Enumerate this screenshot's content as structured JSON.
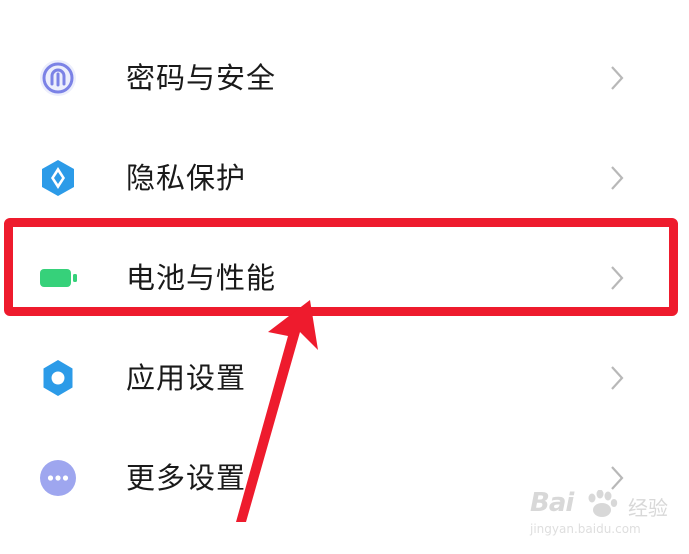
{
  "settings": {
    "items": [
      {
        "label": "密码与安全",
        "icon": "fingerprint-icon",
        "icon_color": "#7b82e6"
      },
      {
        "label": "隐私保护",
        "icon": "privacy-shield-icon",
        "icon_color": "#2c9be8"
      },
      {
        "label": "电池与性能",
        "icon": "battery-icon",
        "icon_color": "#36d17a"
      },
      {
        "label": "应用设置",
        "icon": "gear-icon",
        "icon_color": "#2c9be8"
      },
      {
        "label": "更多设置",
        "icon": "more-dots-icon",
        "icon_color": "#9ea6ef"
      }
    ]
  },
  "annotation": {
    "highlight_color": "#ee1b2d",
    "highlighted_item": "电池与性能"
  },
  "watermark": {
    "brand": "Bai",
    "brand_tag": "经验",
    "url": "jingyan.baidu.com"
  }
}
